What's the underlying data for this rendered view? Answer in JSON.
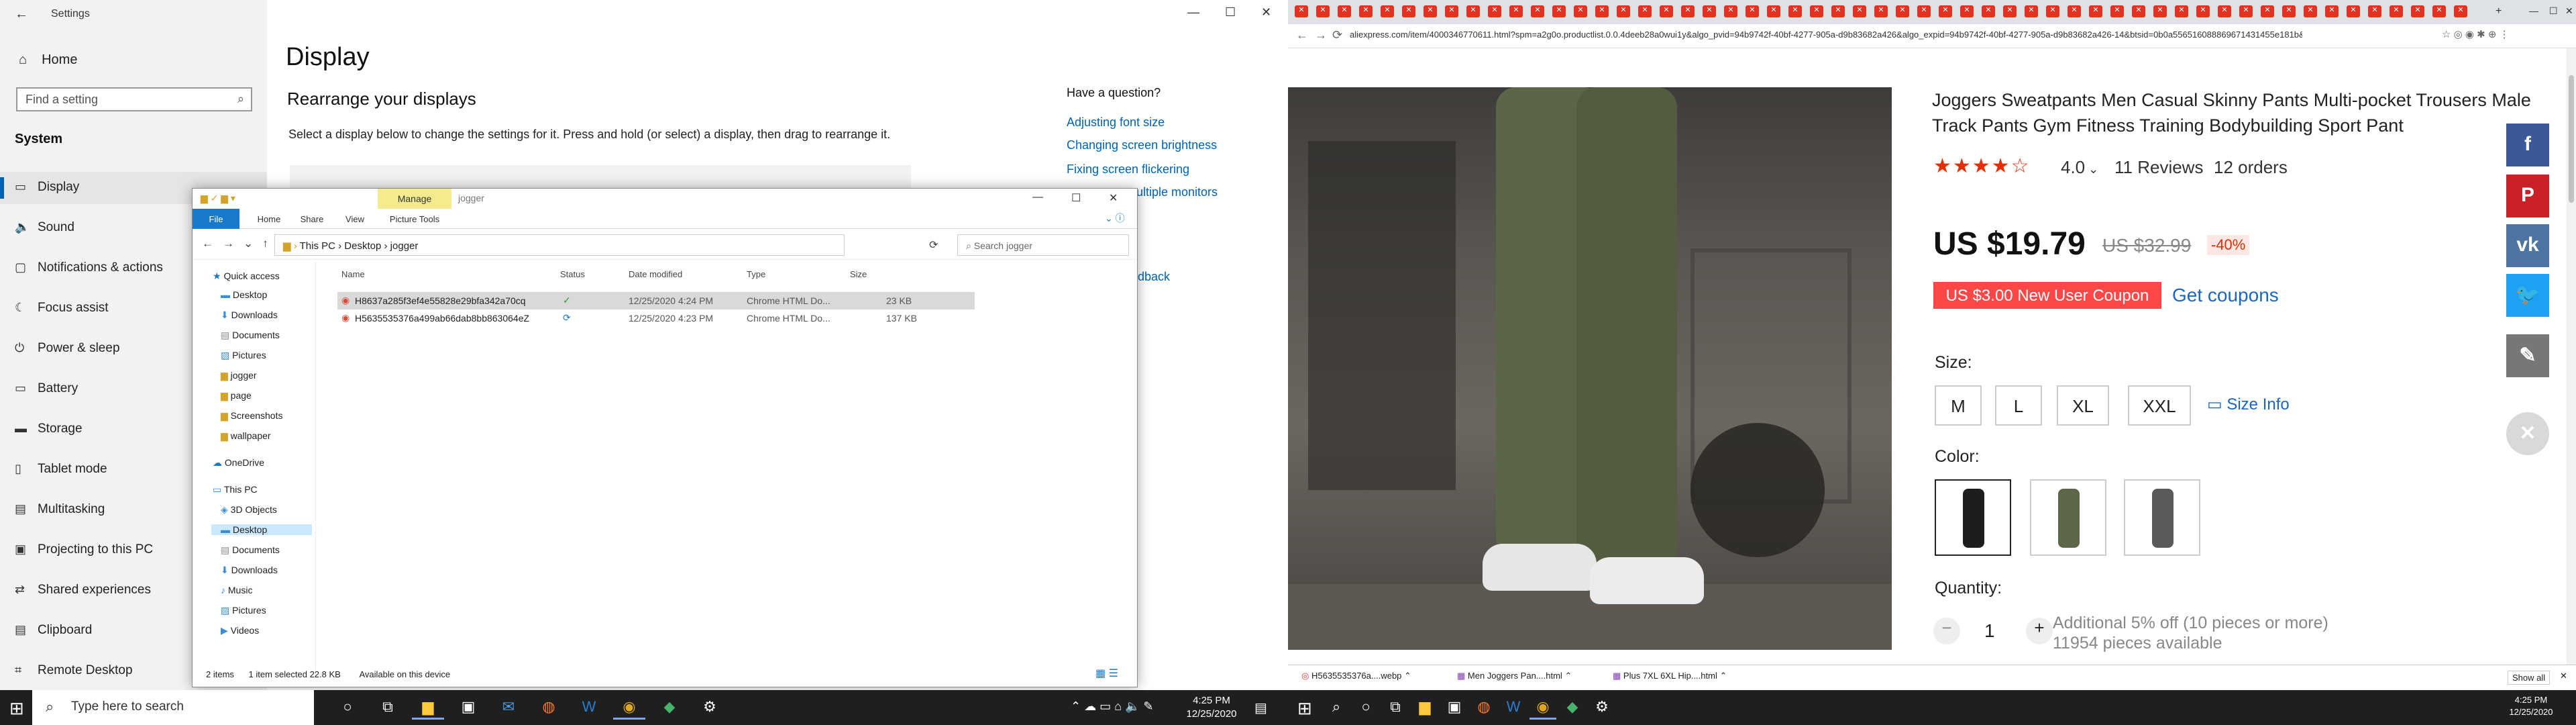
{
  "settings": {
    "window_title": "Settings",
    "home": "Home",
    "search_placeholder": "Find a setting",
    "system_header": "System",
    "nav": [
      {
        "icon": "display-icon",
        "label": "Display"
      },
      {
        "icon": "sound-icon",
        "label": "Sound"
      },
      {
        "icon": "notifications-icon",
        "label": "Notifications & actions"
      },
      {
        "icon": "focus-assist-icon",
        "label": "Focus assist"
      },
      {
        "icon": "power-icon",
        "label": "Power & sleep"
      },
      {
        "icon": "battery-icon",
        "label": "Battery"
      },
      {
        "icon": "storage-icon",
        "label": "Storage"
      },
      {
        "icon": "tablet-icon",
        "label": "Tablet mode"
      },
      {
        "icon": "multitasking-icon",
        "label": "Multitasking"
      },
      {
        "icon": "projecting-icon",
        "label": "Projecting to this PC"
      },
      {
        "icon": "shared-experiences-icon",
        "label": "Shared experiences"
      },
      {
        "icon": "clipboard-icon",
        "label": "Clipboard"
      },
      {
        "icon": "remote-desktop-icon",
        "label": "Remote Desktop"
      }
    ],
    "page_title": "Display",
    "section_title": "Rearrange your displays",
    "section_desc": "Select a display below to change the settings for it. Press and hold (or select) a display, then drag to rearrange it.",
    "question_title": "Have a question?",
    "links": [
      "Adjusting font size",
      "Changing screen brightness",
      "Fixing screen flickering",
      "ultiple monitors",
      "dback"
    ]
  },
  "explorer": {
    "manage_tab": "Manage",
    "folder_title": "jogger",
    "ribbon_tabs": [
      "File",
      "Home",
      "Share",
      "View",
      "Picture Tools"
    ],
    "breadcrumb": [
      "This PC",
      "Desktop",
      "jogger"
    ],
    "search_placeholder": "Search jogger",
    "tree": [
      {
        "label": "Quick access"
      },
      {
        "label": "Desktop"
      },
      {
        "label": "Downloads"
      },
      {
        "label": "Documents"
      },
      {
        "label": "Pictures"
      },
      {
        "label": "jogger"
      },
      {
        "label": "page"
      },
      {
        "label": "Screenshots"
      },
      {
        "label": "wallpaper"
      },
      {
        "label": "OneDrive"
      },
      {
        "label": "This PC"
      },
      {
        "label": "3D Objects"
      },
      {
        "label": "Desktop"
      },
      {
        "label": "Documents"
      },
      {
        "label": "Downloads"
      },
      {
        "label": "Music"
      },
      {
        "label": "Pictures"
      },
      {
        "label": "Videos"
      }
    ],
    "columns": [
      "Name",
      "Status",
      "Date modified",
      "Type",
      "Size"
    ],
    "rows": [
      {
        "name": "H8637a285f3ef4e55828e29bfa342a70cq",
        "date": "12/25/2020 4:24 PM",
        "type": "Chrome HTML Do...",
        "size": "23 KB"
      },
      {
        "name": "H5635535376a499ab66dab8bb863064eZ",
        "date": "12/25/2020 4:23 PM",
        "type": "Chrome HTML Do...",
        "size": "137 KB"
      }
    ],
    "status": {
      "items": "2 items",
      "selected": "1 item selected  22.8 KB",
      "available": "Available on this device"
    }
  },
  "taskbar_left": {
    "search_placeholder": "Type here to search",
    "time": "4:25 PM",
    "date": "12/25/2020"
  },
  "chrome": {
    "url": "aliexpress.com/item/4000346770611.html?spm=a2g0o.productlist.0.0.4deeb28a0wui1y&algo_pvid=94b9742f-40bf-4277-905a-d9b83682a426&algo_expid=94b9742f-40bf-4277-905a-d9b83682a426-14&btsid=0b0a556516088869671431455e181b&ws...",
    "product": {
      "title": "Joggers Sweatpants Men Casual Skinny Pants Multi-pocket Trousers Male Track Pants Gym Fitness Training Bodybuilding Sport Pant",
      "rating": "4.0",
      "reviews": "11 Reviews",
      "orders": "12 orders",
      "price": "US $19.79",
      "old_price": "US $32.99",
      "discount": "-40%",
      "coupon": "US $3.00 New User Coupon",
      "get_coupons": "Get coupons",
      "size_label": "Size:",
      "sizes": [
        "M",
        "L",
        "XL",
        "XXL"
      ],
      "size_info": "Size Info",
      "color_label": "Color:",
      "colors": [
        "#1d1d1d",
        "#5c6648",
        "#5a5a5a"
      ],
      "quantity_label": "Quantity:",
      "quantity": "1",
      "additional": "Additional 5% off (10 pieces or more)",
      "available": "11954 pieces available"
    },
    "downloads": [
      "H5635535376a....webp",
      "Men Joggers Pan....html",
      "Plus 7XL 6XL Hip....html"
    ],
    "show_all": "Show all"
  },
  "taskbar_right": {
    "time": "4:25 PM",
    "date": "12/25/2020"
  }
}
